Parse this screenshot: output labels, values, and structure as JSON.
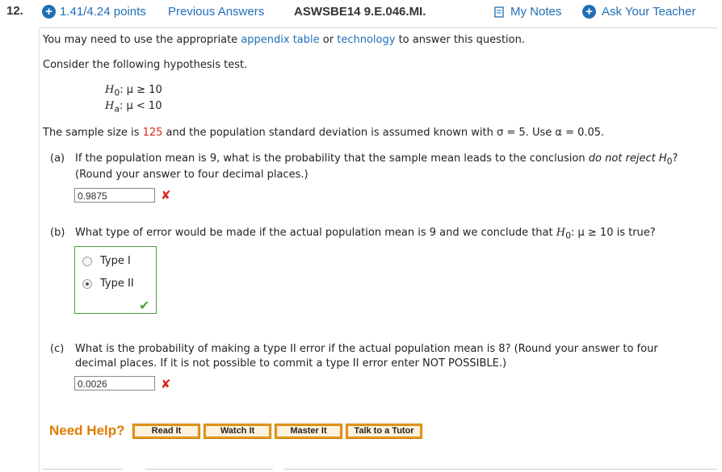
{
  "header": {
    "question_number": "12.",
    "points": "1.41/4.24 points",
    "previous_answers": "Previous Answers",
    "question_code": "ASWSBE14 9.E.046.MI.",
    "my_notes": "My Notes",
    "ask_teacher": "Ask Your Teacher"
  },
  "intro": {
    "p1_before": "You may need to use the appropriate",
    "appendix_link": "appendix table",
    "p1_or": "or",
    "technology_link": "technology",
    "p1_after": "to answer this question.",
    "p2": "Consider the following hypothesis test.",
    "h0": "H",
    "h0_sub": "0",
    "h0_rest": ": μ ≥ 10",
    "ha": "H",
    "ha_sub": "a",
    "ha_rest": ": μ < 10",
    "p3_before": "The sample size is",
    "sample_size": "125",
    "p3_after": "and the population standard deviation is assumed known with σ = 5. Use α = 0.05."
  },
  "part_a": {
    "label": "(a)",
    "q_line1": "If the population mean is 9, what is the probability that the sample mean leads to the conclusion",
    "q_italic": "do not reject H",
    "q_sub": "0",
    "q_end": "?",
    "q_line2": "(Round your answer to four decimal places.)",
    "answer": "0.9875",
    "status": "incorrect"
  },
  "part_b": {
    "label": "(b)",
    "q_before": "What type of error would be made if the actual population mean is 9 and we conclude that",
    "q_h": "H",
    "q_sub": "0",
    "q_after": ": μ ≥ 10 is true?",
    "options": [
      "Type I",
      "Type II"
    ],
    "selected": "Type II",
    "status": "correct"
  },
  "part_c": {
    "label": "(c)",
    "q_line1": "What is the probability of making a type II error if the actual population mean is 8? (Round your answer to four",
    "q_line2": "decimal places. If it is not possible to commit a type II error enter NOT POSSIBLE.)",
    "answer": "0.0026",
    "status": "incorrect"
  },
  "help": {
    "label": "Need Help?",
    "buttons": [
      "Read It",
      "Watch It",
      "Master It",
      "Talk to a Tutor"
    ]
  },
  "colors": {
    "link": "#1f6fb5",
    "incorrect": "#d9261c",
    "correct": "#4aa23a",
    "help_orange": "#e07c00"
  }
}
